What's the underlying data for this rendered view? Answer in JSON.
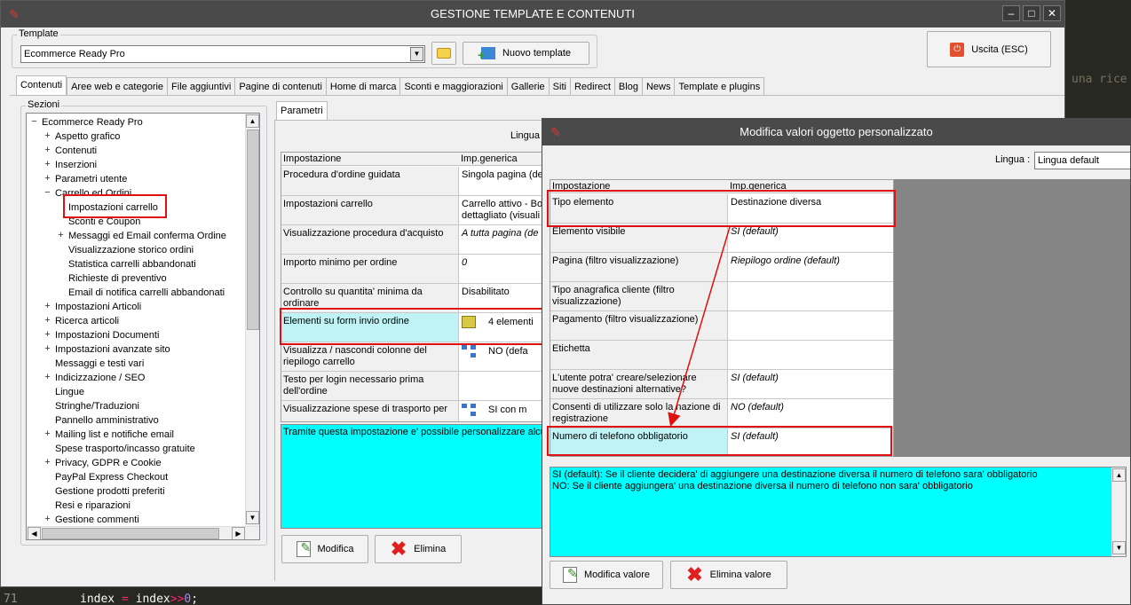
{
  "main_window": {
    "title": "GESTIONE TEMPLATE E CONTENUTI",
    "controls": {
      "minimize": "–",
      "maximize": "□",
      "close": "✕"
    }
  },
  "template_section": {
    "label": "Template",
    "selected": "Ecommerce Ready Pro",
    "new_button": "Nuovo template"
  },
  "exit_button": "Uscita (ESC)",
  "tabs": [
    "Contenuti",
    "Aree web e categorie",
    "File aggiuntivi",
    "Pagine di contenuti",
    "Home di marca",
    "Sconti e maggiorazioni",
    "Gallerie",
    "Siti",
    "Redirect",
    "Blog",
    "News",
    "Template e plugins"
  ],
  "sections": {
    "label": "Sezioni",
    "tree": [
      {
        "label": "Ecommerce Ready Pro",
        "level": 0,
        "exp": "−"
      },
      {
        "label": "Aspetto grafico",
        "level": 1,
        "exp": "+"
      },
      {
        "label": "Contenuti",
        "level": 1,
        "exp": "+"
      },
      {
        "label": "Inserzioni",
        "level": 1,
        "exp": "+"
      },
      {
        "label": "Parametri utente",
        "level": 1,
        "exp": "+"
      },
      {
        "label": "Carrello ed Ordini",
        "level": 1,
        "exp": "−"
      },
      {
        "label": "Impostazioni carrello",
        "level": 2,
        "exp": ""
      },
      {
        "label": "Sconti e Coupon",
        "level": 2,
        "exp": ""
      },
      {
        "label": "Messaggi ed Email conferma Ordine",
        "level": 2,
        "exp": "+"
      },
      {
        "label": "Visualizzazione storico ordini",
        "level": 2,
        "exp": ""
      },
      {
        "label": "Statistica carrelli abbandonati",
        "level": 2,
        "exp": ""
      },
      {
        "label": "Richieste di preventivo",
        "level": 2,
        "exp": ""
      },
      {
        "label": "Email di notifica carrelli abbandonati",
        "level": 2,
        "exp": ""
      },
      {
        "label": "Impostazioni Articoli",
        "level": 1,
        "exp": "+"
      },
      {
        "label": "Ricerca articoli",
        "level": 1,
        "exp": "+"
      },
      {
        "label": "Impostazioni Documenti",
        "level": 1,
        "exp": "+"
      },
      {
        "label": "Impostazioni avanzate sito",
        "level": 1,
        "exp": "+"
      },
      {
        "label": "Messaggi e testi vari",
        "level": 1,
        "exp": ""
      },
      {
        "label": "Indicizzazione / SEO",
        "level": 1,
        "exp": "+"
      },
      {
        "label": "Lingue",
        "level": 1,
        "exp": ""
      },
      {
        "label": "Stringhe/Traduzioni",
        "level": 1,
        "exp": ""
      },
      {
        "label": "Pannello amministrativo",
        "level": 1,
        "exp": ""
      },
      {
        "label": "Mailing list e notifiche email",
        "level": 1,
        "exp": "+"
      },
      {
        "label": "Spese trasporto/incasso gratuite",
        "level": 1,
        "exp": ""
      },
      {
        "label": "Privacy, GDPR e Cookie",
        "level": 1,
        "exp": "+"
      },
      {
        "label": "PayPal Express Checkout",
        "level": 1,
        "exp": ""
      },
      {
        "label": "Gestione prodotti preferiti",
        "level": 1,
        "exp": ""
      },
      {
        "label": "Resi e riparazioni",
        "level": 1,
        "exp": ""
      },
      {
        "label": "Gestione commenti",
        "level": 1,
        "exp": "+"
      }
    ]
  },
  "params": {
    "tab": "Parametri",
    "lingua_label": "Lingua :",
    "columns": [
      "Impostazione",
      "Imp.generica"
    ],
    "rows": [
      {
        "name": "Procedura d'ordine guidata",
        "value": "Singola pagina (def",
        "italic": false
      },
      {
        "name": "Impostazioni carrello",
        "value": "Carrello attivo - Bo\ndettagliato (visuali",
        "italic": false
      },
      {
        "name": "Visualizzazione procedura d'acquisto",
        "value": "A tutta pagina (de",
        "italic": true
      },
      {
        "name": "Importo minimo per ordine",
        "value": "0",
        "italic": true
      },
      {
        "name": "Controllo su quantita' minima da ordinare",
        "value": "Disabilitato",
        "italic": false
      },
      {
        "name": "Elementi su form invio ordine",
        "value": "4 elementi",
        "italic": false
      },
      {
        "name": "Visualizza / nascondi colonne del riepilogo carrello",
        "value": "NO (defa",
        "italic": false
      },
      {
        "name": "Testo per login necessario prima dell'ordine",
        "value": "",
        "italic": false
      },
      {
        "name": "Visualizzazione spese di trasporto per",
        "value": "SI con m",
        "italic": false
      }
    ],
    "description": "Tramite questa impostazione e' possibile personalizzare alcun",
    "modify_button": "Modifica",
    "delete_button": "Elimina"
  },
  "dialog": {
    "title": "Modifica valori oggetto personalizzato",
    "lingua_label": "Lingua :",
    "lingua_value": "Lingua default",
    "columns": [
      "Impostazione",
      "Imp.generica"
    ],
    "rows": [
      {
        "name": "Tipo elemento",
        "value": "Destinazione diversa",
        "italic": false
      },
      {
        "name": "Elemento visibile",
        "value": "SI (default)",
        "italic": true
      },
      {
        "name": "Pagina (filtro visualizzazione)",
        "value": "Riepilogo ordine (default)",
        "italic": true
      },
      {
        "name": "Tipo anagrafica cliente (filtro visualizzazione)",
        "value": "",
        "italic": false
      },
      {
        "name": "Pagamento (filtro visualizzazione)",
        "value": "",
        "italic": false
      },
      {
        "name": "Etichetta",
        "value": "",
        "italic": false
      },
      {
        "name": "L'utente potra' creare/selezionare nuove destinazioni alternative?",
        "value": "SI (default)",
        "italic": true
      },
      {
        "name": "Consenti di utilizzare solo la nazione di registrazione",
        "value": "NO (default)",
        "italic": true
      },
      {
        "name": "Numero di telefono obbligatorio",
        "value": "SI (default)",
        "italic": true
      }
    ],
    "description_line1": "SI (default): Se il cliente decidera' di aggiungere una destinazione diversa il numero di telefono sara' obbligatorio",
    "description_line2": "NO: Se il cliente aggiungera' una destinazione diversa il numero di telefono non sara' obbligatorio",
    "modify_button": "Modifica valore",
    "delete_button": "Elimina valore"
  },
  "background": {
    "editor_text": "una rice",
    "line_number": "71",
    "code_a": "index",
    "code_eq": "=",
    "code_b": "index",
    "code_op": ">>",
    "code_num": "0",
    "code_end": ";"
  },
  "colors": {
    "description_bg": "#00ffff",
    "selected_row_bg": "#bff3f6",
    "highlight": "#e01010",
    "titlebar": "#4a4a4a"
  }
}
